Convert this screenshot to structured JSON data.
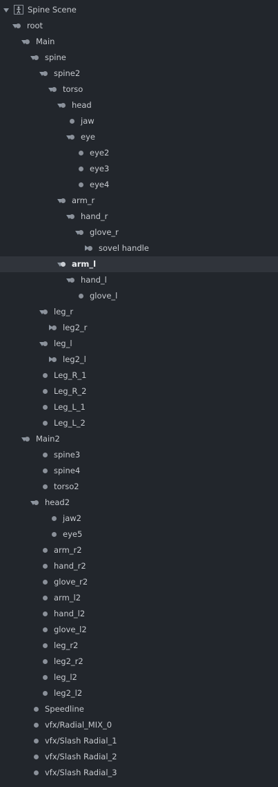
{
  "outline": {
    "items": [
      {
        "label": "Spine Scene",
        "icon": "spine-scene-icon",
        "depth": 0,
        "toggle": "expanded"
      },
      {
        "label": "root",
        "depth": 1,
        "toggle": "expanded"
      },
      {
        "label": "Main",
        "depth": 2,
        "toggle": "expanded"
      },
      {
        "label": "spine",
        "depth": 3,
        "toggle": "expanded"
      },
      {
        "label": "spine2",
        "depth": 4,
        "toggle": "expanded"
      },
      {
        "label": "torso",
        "depth": 5,
        "toggle": "expanded"
      },
      {
        "label": "head",
        "depth": 6,
        "toggle": "expanded"
      },
      {
        "label": "jaw",
        "depth": 7,
        "toggle": "none"
      },
      {
        "label": "eye",
        "depth": 7,
        "toggle": "expanded"
      },
      {
        "label": "eye2",
        "depth": 8,
        "toggle": "none"
      },
      {
        "label": "eye3",
        "depth": 8,
        "toggle": "none"
      },
      {
        "label": "eye4",
        "depth": 8,
        "toggle": "none"
      },
      {
        "label": "arm_r",
        "depth": 6,
        "toggle": "expanded"
      },
      {
        "label": "hand_r",
        "depth": 7,
        "toggle": "expanded"
      },
      {
        "label": "glove_r",
        "depth": 8,
        "toggle": "expanded"
      },
      {
        "label": "sovel handle",
        "depth": 9,
        "toggle": "collapsed"
      },
      {
        "label": "arm_l",
        "depth": 6,
        "toggle": "expanded",
        "selected": true
      },
      {
        "label": "hand_l",
        "depth": 7,
        "toggle": "expanded"
      },
      {
        "label": "glove_l",
        "depth": 8,
        "toggle": "none"
      },
      {
        "label": "leg_r",
        "depth": 4,
        "toggle": "expanded"
      },
      {
        "label": "leg2_r",
        "depth": 5,
        "toggle": "collapsed"
      },
      {
        "label": "leg_l",
        "depth": 4,
        "toggle": "expanded"
      },
      {
        "label": "leg2_l",
        "depth": 5,
        "toggle": "collapsed"
      },
      {
        "label": "Leg_R_1",
        "depth": 4,
        "toggle": "none"
      },
      {
        "label": "Leg_R_2",
        "depth": 4,
        "toggle": "none"
      },
      {
        "label": "Leg_L_1",
        "depth": 4,
        "toggle": "none"
      },
      {
        "label": "Leg_L_2",
        "depth": 4,
        "toggle": "none"
      },
      {
        "label": "Main2",
        "depth": 2,
        "toggle": "expanded"
      },
      {
        "label": "spine3",
        "depth": 4,
        "toggle": "none"
      },
      {
        "label": "spine4",
        "depth": 4,
        "toggle": "none"
      },
      {
        "label": "torso2",
        "depth": 4,
        "toggle": "none"
      },
      {
        "label": "head2",
        "depth": 3,
        "toggle": "expanded"
      },
      {
        "label": "jaw2",
        "depth": 5,
        "toggle": "none"
      },
      {
        "label": "eye5",
        "depth": 5,
        "toggle": "none"
      },
      {
        "label": "arm_r2",
        "depth": 4,
        "toggle": "none"
      },
      {
        "label": "hand_r2",
        "depth": 4,
        "toggle": "none"
      },
      {
        "label": "glove_r2",
        "depth": 4,
        "toggle": "none"
      },
      {
        "label": "arm_l2",
        "depth": 4,
        "toggle": "none"
      },
      {
        "label": "hand_l2",
        "depth": 4,
        "toggle": "none"
      },
      {
        "label": "glove_l2",
        "depth": 4,
        "toggle": "none"
      },
      {
        "label": "leg_r2",
        "depth": 4,
        "toggle": "none"
      },
      {
        "label": "leg2_r2",
        "depth": 4,
        "toggle": "none"
      },
      {
        "label": "leg_l2",
        "depth": 4,
        "toggle": "none"
      },
      {
        "label": "leg2_l2",
        "depth": 4,
        "toggle": "none"
      },
      {
        "label": "Speedline",
        "depth": 3,
        "toggle": "none"
      },
      {
        "label": "vfx/Radial_MIX_0",
        "depth": 3,
        "toggle": "none"
      },
      {
        "label": "vfx/Slash Radial_1",
        "depth": 3,
        "toggle": "none"
      },
      {
        "label": "vfx/Slash Radial_2",
        "depth": 3,
        "toggle": "none"
      },
      {
        "label": "vfx/Slash Radial_3",
        "depth": 3,
        "toggle": "none"
      }
    ]
  },
  "colors": {
    "background": "#22262c",
    "selected_row": "#30343b",
    "text": "#c6c9ce",
    "dot": "#8a9099",
    "arrow": "#8d96a1"
  }
}
